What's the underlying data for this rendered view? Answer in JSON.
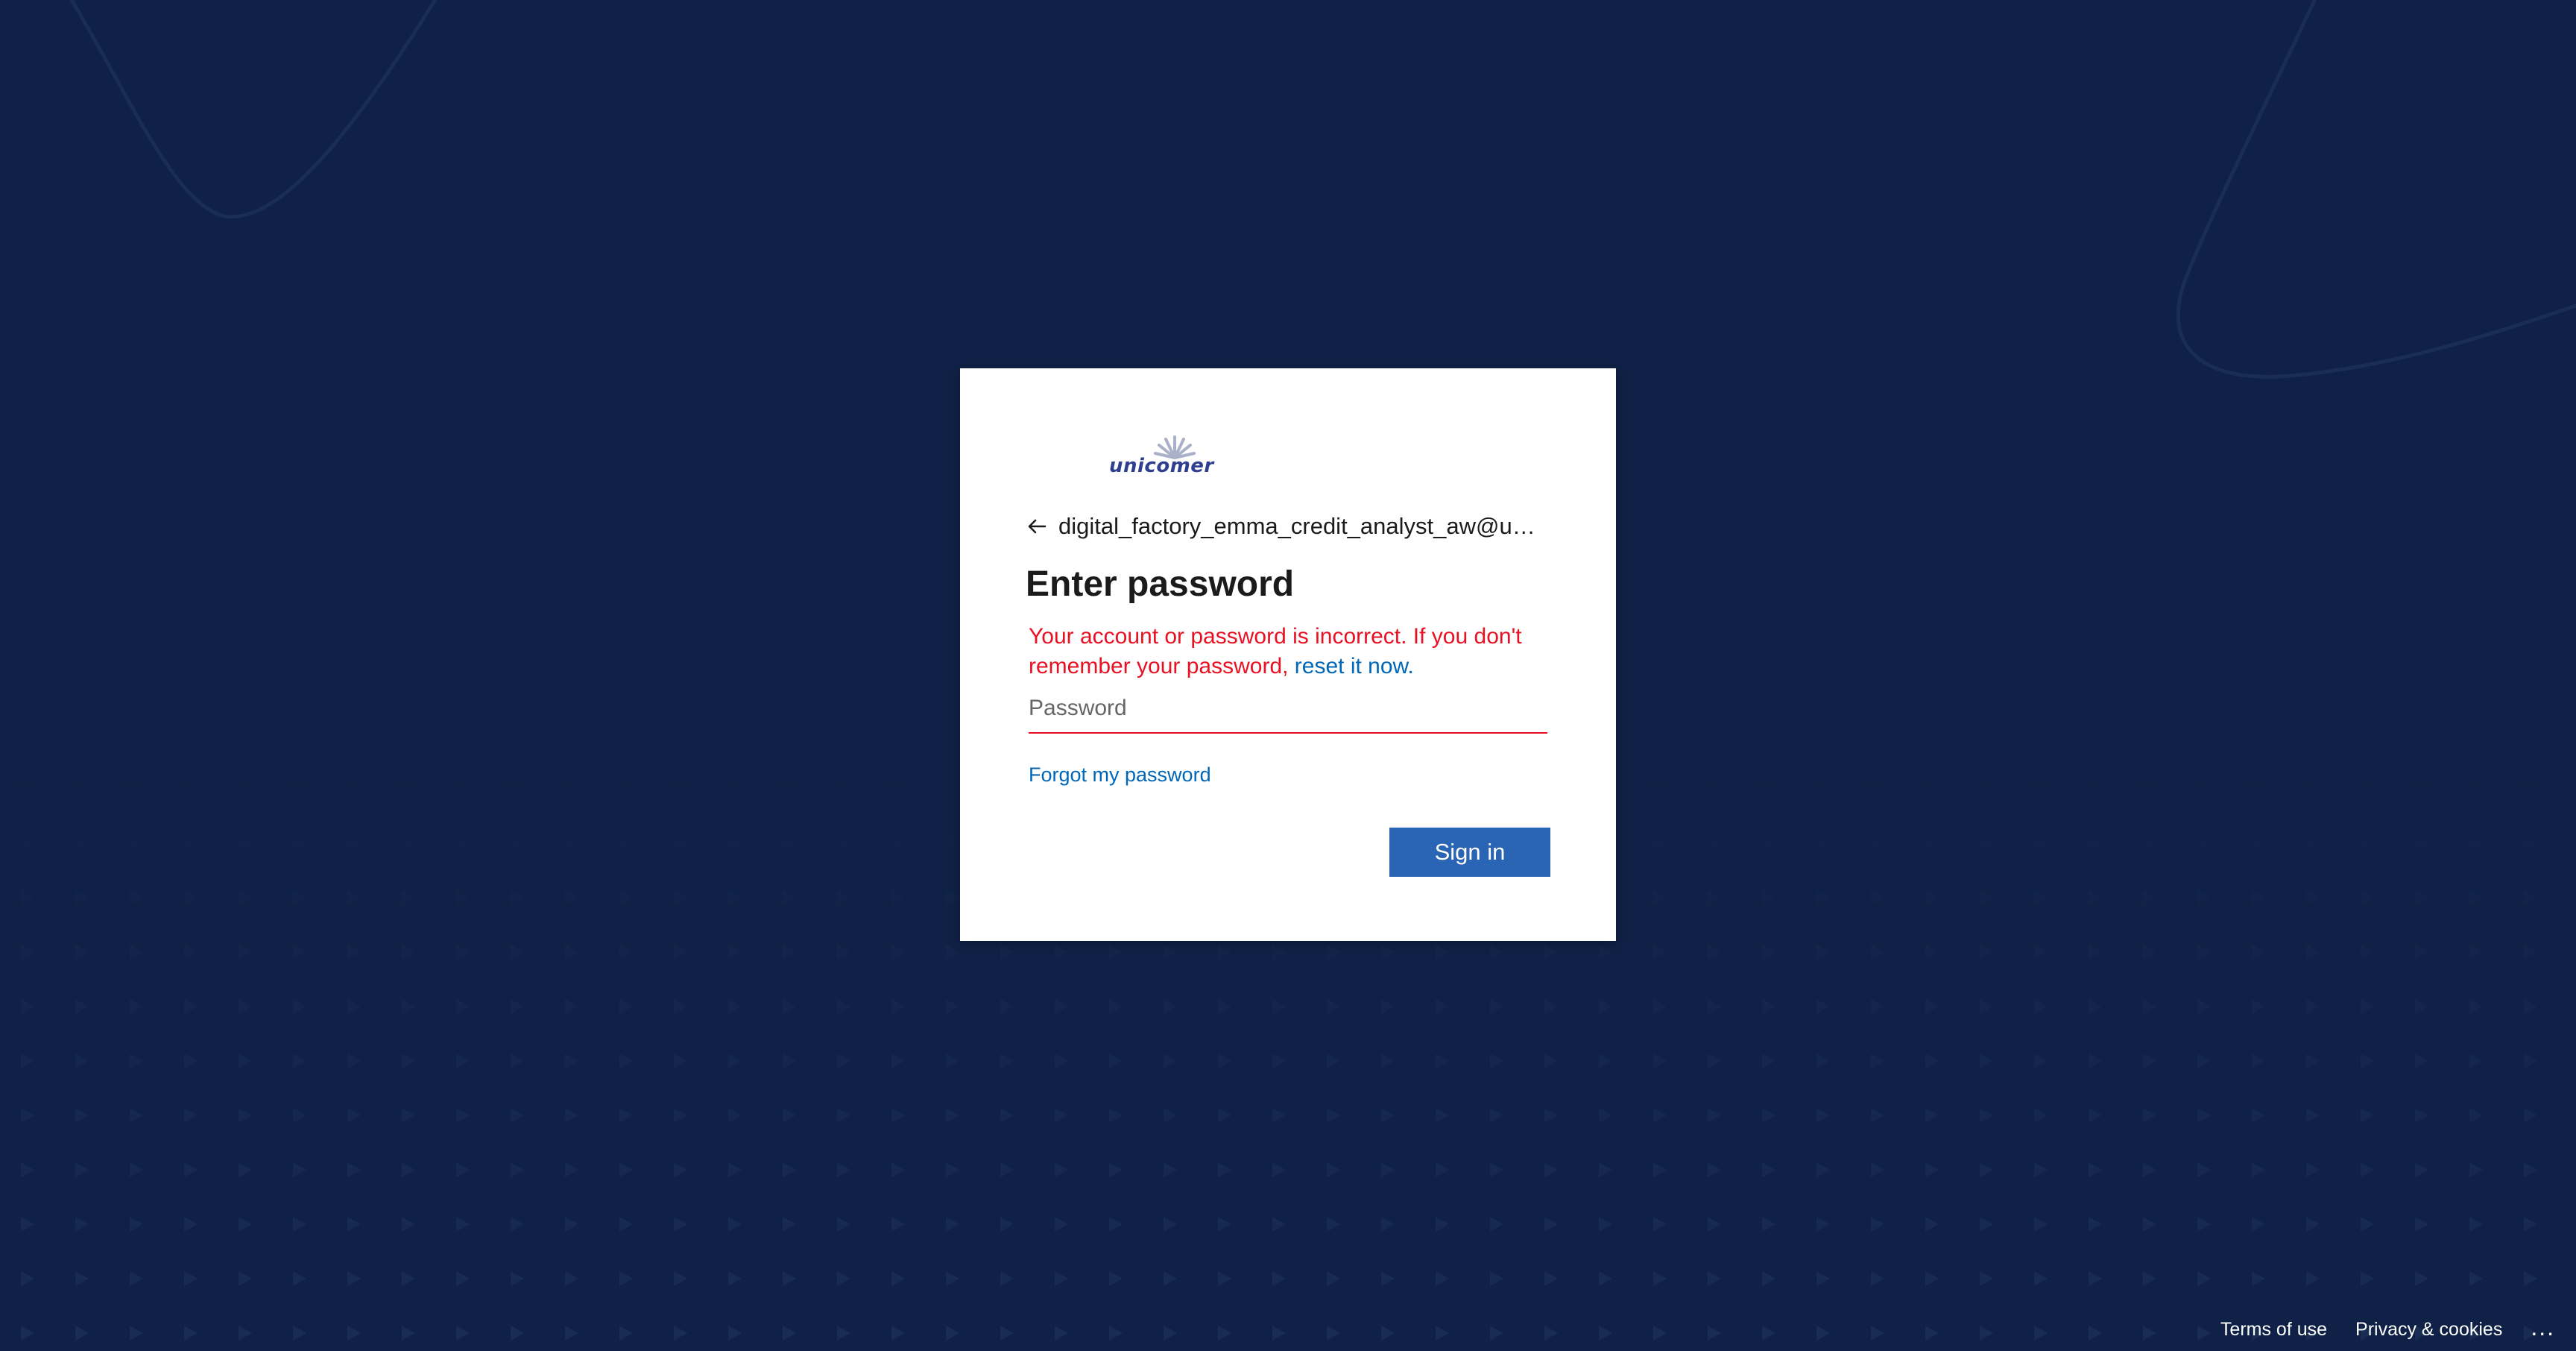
{
  "brand": {
    "logo_text": "unicomer"
  },
  "login": {
    "identity": "digital_factory_emma_credit_analyst_aw@unicomer.com",
    "title": "Enter password",
    "error_text": "Your account or password is incorrect. If you don't remember your password, ",
    "error_link": "reset it now.",
    "password_placeholder": "Password",
    "password_value": "",
    "forgot_link": "Forgot my password",
    "sign_in_label": "Sign in"
  },
  "footer": {
    "terms": "Terms of use",
    "privacy": "Privacy & cookies",
    "more": "..."
  },
  "colors": {
    "background": "#0f2146",
    "card": "#ffffff",
    "error": "#e81123",
    "link": "#0067b8",
    "button": "#2a64b4"
  },
  "icons": {
    "back": "back-arrow-icon",
    "more": "ellipsis-icon"
  }
}
